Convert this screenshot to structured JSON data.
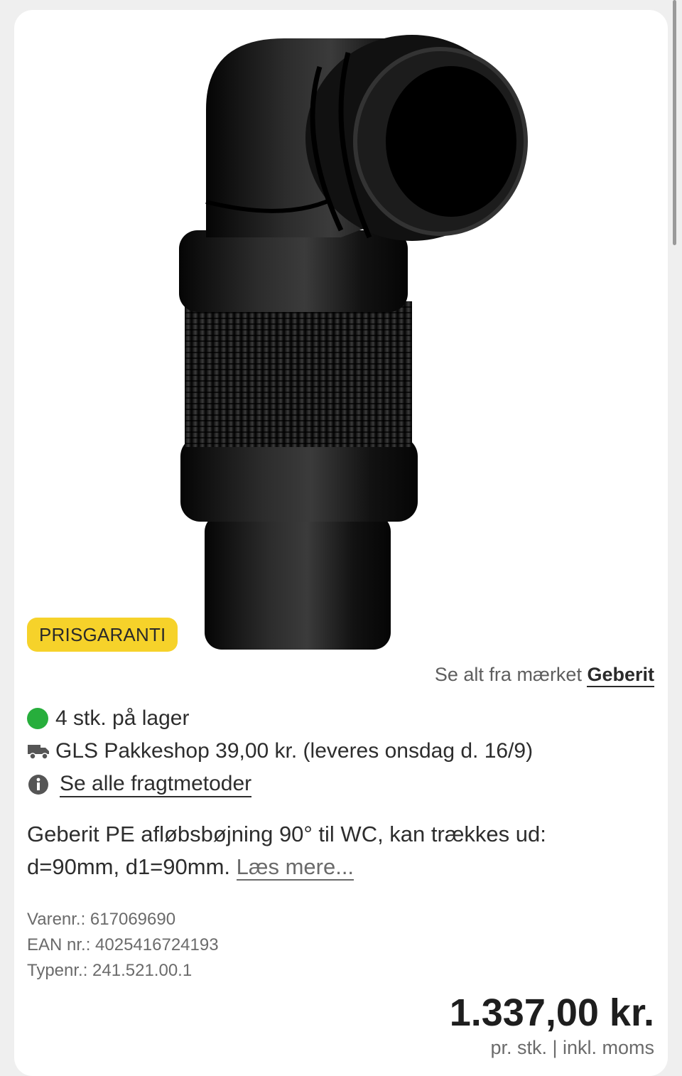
{
  "product": {
    "image_alt": "Geberit PE afløbsbøjning 90°",
    "badge": "PRISGARANTI"
  },
  "brand": {
    "prefix": "Se alt fra mærket",
    "name": "Geberit"
  },
  "availability": {
    "stock_status_color": "#27ae3c",
    "stock_text": "4 stk. på lager",
    "shipping_icon": "truck-icon",
    "shipping_text": "GLS Pakkeshop 39,00 kr. (leveres onsdag d. 16/9)",
    "info_icon": "info-icon",
    "shipping_methods_link": "Se alle fragtmetoder"
  },
  "description": {
    "text": "Geberit PE afløbsbøjning 90° til WC, kan trækkes ud: d=90mm, d1=90mm.",
    "read_more": "Læs mere..."
  },
  "identifiers": {
    "varenr": "Varenr.: 617069690",
    "ean": "EAN nr.: 4025416724193",
    "typenr": "Typenr.: 241.521.00.1"
  },
  "pricing": {
    "price": "1.337,00 kr.",
    "unit_note": "pr. stk. | inkl. moms"
  },
  "colors": {
    "badge_bg": "#f6d22a",
    "stock_green": "#27ae3c"
  }
}
